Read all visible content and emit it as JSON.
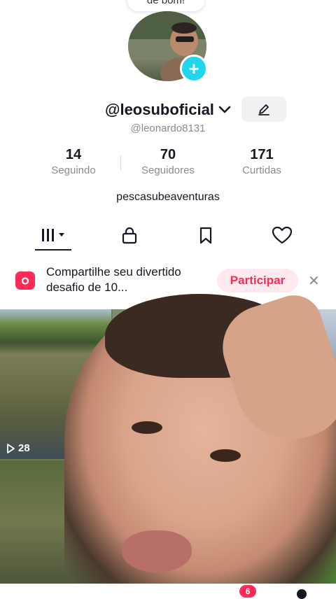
{
  "tooltip": {
    "text": "de bom!"
  },
  "profile": {
    "username": "@leosuboficial",
    "handle": "@leonardo8131",
    "bio": "pescasubeaventuras"
  },
  "stats": [
    {
      "value": "14",
      "label": "Seguindo"
    },
    {
      "value": "70",
      "label": "Seguidores"
    },
    {
      "value": "171",
      "label": "Curtidas"
    }
  ],
  "tabs": [
    {
      "icon": "grid-icon",
      "active": true
    },
    {
      "icon": "lock-icon",
      "active": false
    },
    {
      "icon": "bookmark-icon",
      "active": false
    },
    {
      "icon": "heart-icon",
      "active": false
    }
  ],
  "challenge": {
    "text": "Compartilhe seu divertido desafio de 10...",
    "button": "Participar"
  },
  "videos": [
    {
      "views": "28"
    }
  ],
  "nav": {
    "badge": "6"
  },
  "colors": {
    "accent": "#fe2c55",
    "cyan": "#20d5ec"
  }
}
